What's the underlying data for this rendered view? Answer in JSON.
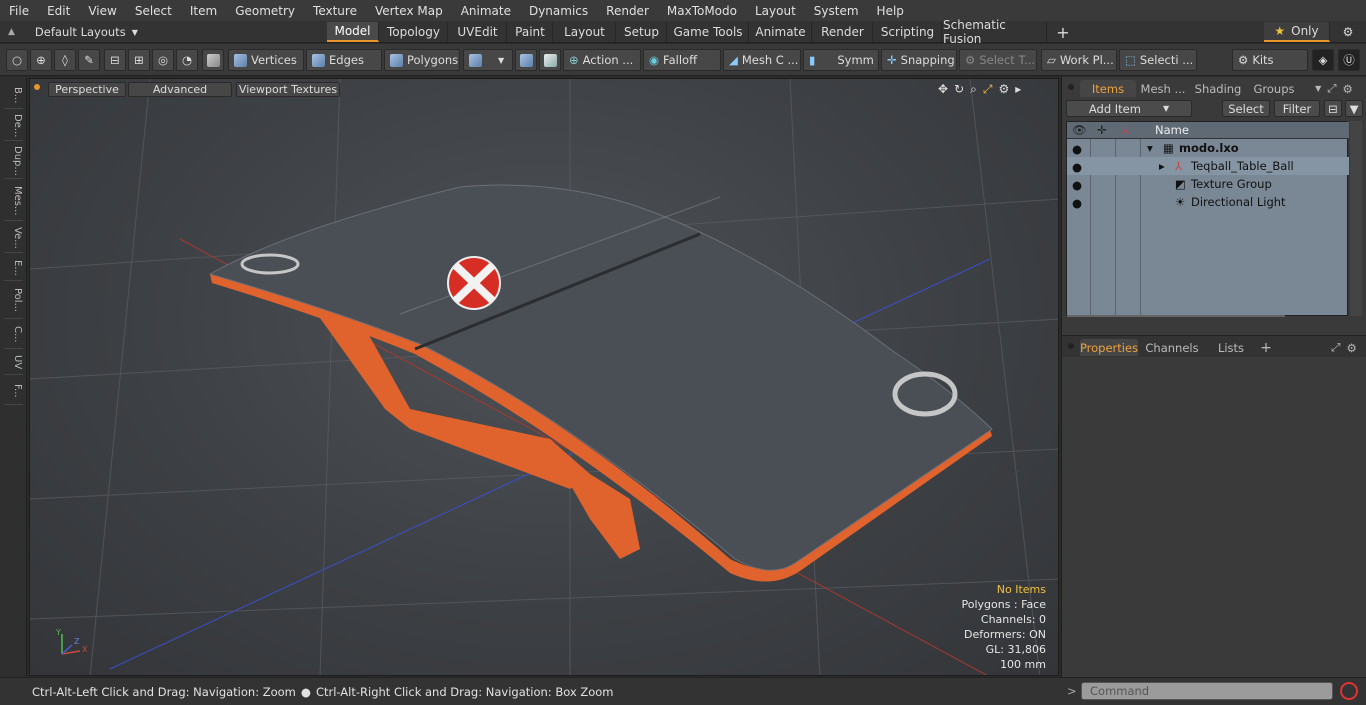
{
  "menu": [
    "File",
    "Edit",
    "View",
    "Select",
    "Item",
    "Geometry",
    "Texture",
    "Vertex Map",
    "Animate",
    "Dynamics",
    "Render",
    "MaxToModo",
    "Layout",
    "System",
    "Help"
  ],
  "layout_selector": "Default Layouts",
  "main_tabs": [
    "Model",
    "Topology",
    "UVEdit",
    "Paint",
    "Layout",
    "Setup",
    "Game Tools",
    "Animate",
    "Render",
    "Scripting",
    "Schematic Fusion"
  ],
  "active_tab": "Model",
  "only_label": "Only",
  "toolbar": {
    "vertices": "Vertices",
    "edges": "Edges",
    "polygons": "Polygons",
    "action": "Action ...",
    "falloff": "Falloff",
    "mesh": "Mesh C ...",
    "symmetry": "Symm ...",
    "snapping": "Snapping",
    "select_t": "Select T...",
    "work_plane": "Work Pl...",
    "selection": "Selecti ...",
    "kits": "Kits"
  },
  "left_tabs": [
    "B...",
    "De...",
    "Dup...",
    "Mes...",
    "Ve...",
    "E...",
    "Pol...",
    "C...",
    "UV",
    "F..."
  ],
  "viewport": {
    "perspective": "Perspective",
    "advanced": "Advanced",
    "textures": "Viewport Textures",
    "info": {
      "no_items": "No Items",
      "polygons": "Polygons : Face",
      "channels": "Channels: 0",
      "deformers": "Deformers: ON",
      "gl": "GL: 31,806",
      "scale": "100 mm"
    },
    "axis": {
      "x": "X",
      "y": "Y",
      "z": "Z"
    },
    "colors": {
      "table_top": "#4a4e55",
      "table_frame": "#e0622c",
      "ball": "#d62e25",
      "info_highlight": "#f0c23a"
    }
  },
  "items_panel": {
    "tabs": [
      "Items",
      "Mesh ...",
      "Shading",
      "Groups"
    ],
    "active_tab": "Items",
    "add_item": "Add Item",
    "select": "Select",
    "filter": "Filter",
    "column_name": "Name",
    "rows": [
      "modo.lxo",
      "Teqball_Table_Ball",
      "Texture Group",
      "Directional Light"
    ]
  },
  "properties_panel": {
    "tabs": [
      "Properties",
      "Channels",
      "Lists"
    ],
    "active_tab": "Properties"
  },
  "status": {
    "hint1": "Ctrl-Alt-Left Click and Drag: Navigation: Zoom",
    "hint2": "Ctrl-Alt-Right Click and Drag: Navigation: Box Zoom"
  },
  "command": {
    "placeholder": "Command"
  }
}
